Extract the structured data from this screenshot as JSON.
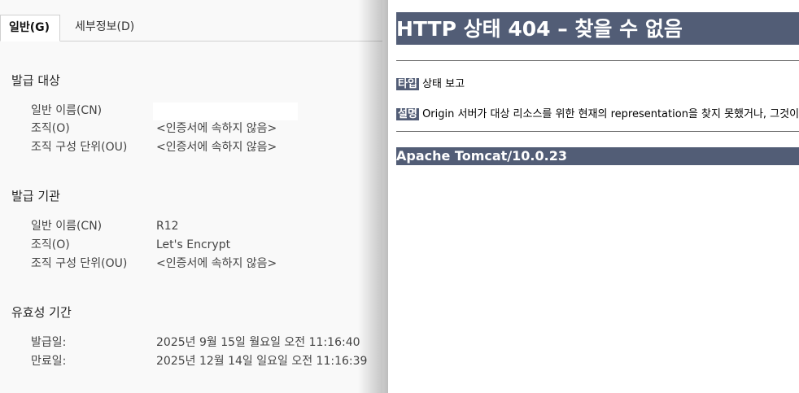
{
  "cert_dialog": {
    "tabs": [
      {
        "label": "일반(G)",
        "active": true
      },
      {
        "label": "세부정보(D)",
        "active": false
      }
    ],
    "issued_to": {
      "title": "발급 대상",
      "fields": [
        {
          "label": "일반 이름(CN)",
          "value": ""
        },
        {
          "label": "조직(O)",
          "value": "<인증서에 속하지 않음>"
        },
        {
          "label": "조직 구성 단위(OU)",
          "value": "<인증서에 속하지 않음>"
        }
      ]
    },
    "issued_by": {
      "title": "발급 기관",
      "fields": [
        {
          "label": "일반 이름(CN)",
          "value": "R12"
        },
        {
          "label": "조직(O)",
          "value": "Let's Encrypt"
        },
        {
          "label": "조직 구성 단위(OU)",
          "value": "<인증서에 속하지 않음>"
        }
      ]
    },
    "validity": {
      "title": "유효성 기간",
      "fields": [
        {
          "label": "발급일:",
          "value": "2025년 9월 15일 월요일 오전 11:16:40"
        },
        {
          "label": "만료일:",
          "value": "2025년 12월 14일 일요일 오전 11:16:39"
        }
      ]
    }
  },
  "error_page": {
    "title": "HTTP 상태 404 – 찾을 수 없음",
    "type_key": "타입",
    "type_value": "상태 보고",
    "desc_key": "설명",
    "desc_value": "Origin 서버가 대상 리소스를 위한 현재의 representation을 찾지 못했거나, 그것이 존재하는지를 밝히려 하지 않습니다.",
    "footer": "Apache Tomcat/10.0.23"
  },
  "colors": {
    "tomcat_bar": "#525d76"
  }
}
